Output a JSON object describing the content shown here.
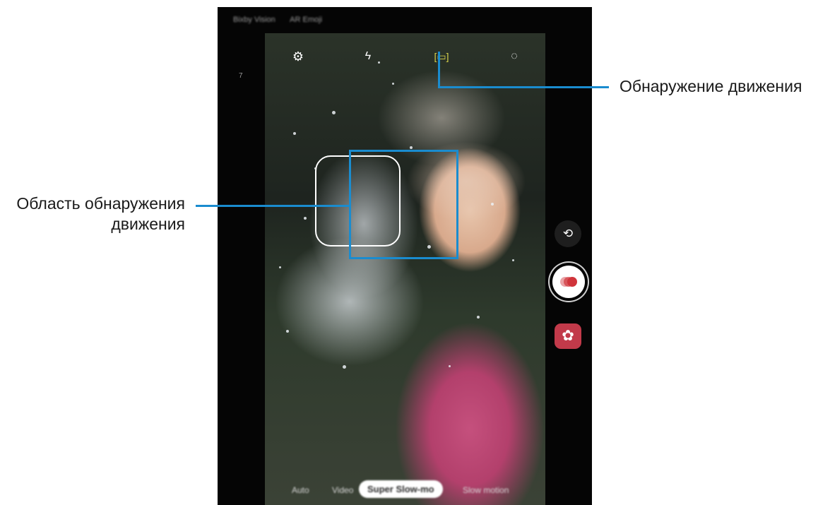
{
  "callouts": {
    "motion_detection": "Обнаружение движения",
    "motion_area_line1": "Область обнаружения",
    "motion_area_line2": "движения"
  },
  "top_modes": [
    "Bixby Vision",
    "AR Emoji"
  ],
  "side_indicator": "7",
  "camera_modes": {
    "hyperlapse": "Auto",
    "video": "Video",
    "super_slow": "Super Slow-mo",
    "slow_motion": "Slow motion"
  },
  "icons": {
    "settings": "gear-icon",
    "flash_off": "flash-off-icon",
    "motion_detection": "motion-detect-icon",
    "timer": "timer-icon",
    "switch_camera": "switch-camera-icon",
    "record": "super-slow-record-icon",
    "effects": "effects-icon"
  },
  "colors": {
    "callout_line": "#1a8ccf",
    "record_dot": "#d0343b",
    "effects_button": "#c23a4a",
    "motion_icon_active": "#d8d24a"
  }
}
